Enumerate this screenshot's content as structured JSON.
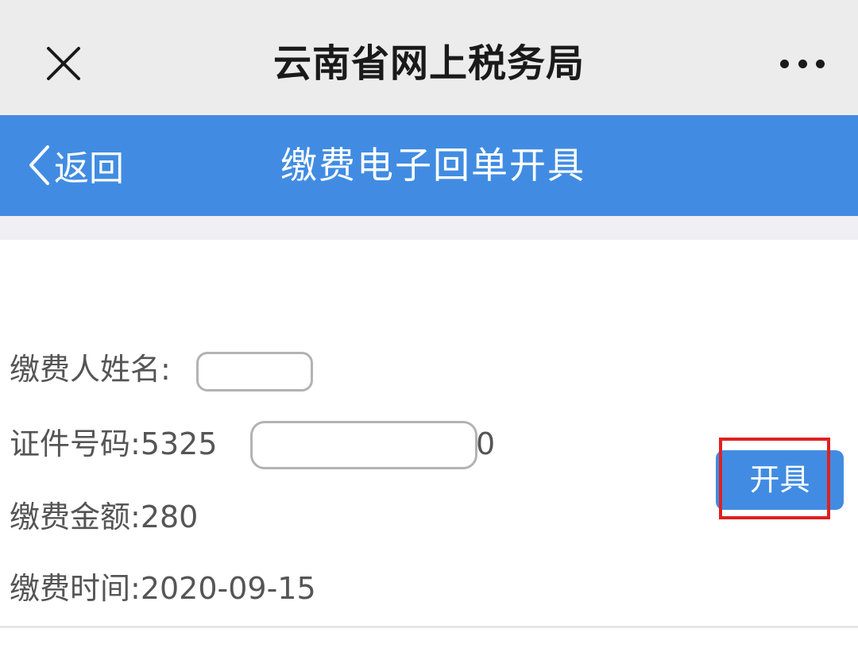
{
  "topbar": {
    "title": "云南省网上税务局",
    "close_icon": "close-icon",
    "more_icon": "more-dots-icon"
  },
  "navbar": {
    "back_label": "返回",
    "title": "缴费电子回单开具",
    "background": "#418ce2"
  },
  "record": {
    "name_label": "缴费人姓名:",
    "name_value": "",
    "id_label": "证件号码:",
    "id_prefix": "5325",
    "id_suffix": "0",
    "amount_label": "缴费金额:",
    "amount_value": "280",
    "time_label": "缴费时间:",
    "time_value": "2020-09-15"
  },
  "actions": {
    "issue_label": "开具",
    "issue_color": "#418ce2",
    "highlight_color": "#e02020"
  }
}
